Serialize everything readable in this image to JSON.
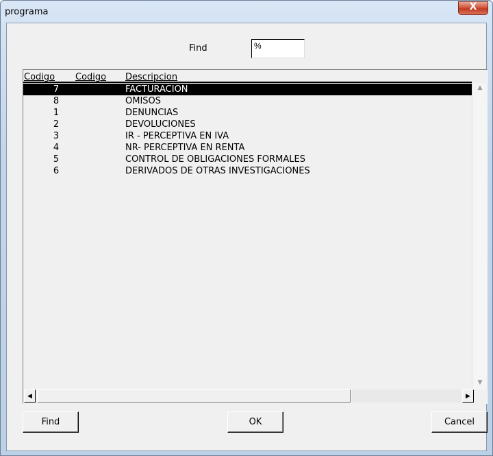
{
  "window": {
    "title": "programa",
    "close_glyph": "X"
  },
  "search": {
    "label": "Find",
    "value": "%"
  },
  "list": {
    "columns": [
      "Codigo",
      "Codigo",
      "Descripcion"
    ],
    "rows": [
      {
        "code": "7",
        "description": "FACTURACION",
        "selected": true
      },
      {
        "code": "8",
        "description": "OMISOS"
      },
      {
        "code": "1",
        "description": "DENUNCIAS"
      },
      {
        "code": "2",
        "description": "DEVOLUCIONES"
      },
      {
        "code": "3",
        "description": "IR - PERCEPTIVA EN IVA"
      },
      {
        "code": "4",
        "description": "NR- PERCEPTIVA EN RENTA"
      },
      {
        "code": "5",
        "description": "CONTROL DE OBLIGACIONES FORMALES"
      },
      {
        "code": "6",
        "description": "DERIVADOS DE OTRAS INVESTIGACIONES"
      }
    ]
  },
  "buttons": {
    "find": "Find",
    "ok": "OK",
    "cancel": "Cancel"
  },
  "scrollbar": {
    "up": "▲",
    "down": "▼",
    "left": "◀",
    "right": "▶"
  }
}
